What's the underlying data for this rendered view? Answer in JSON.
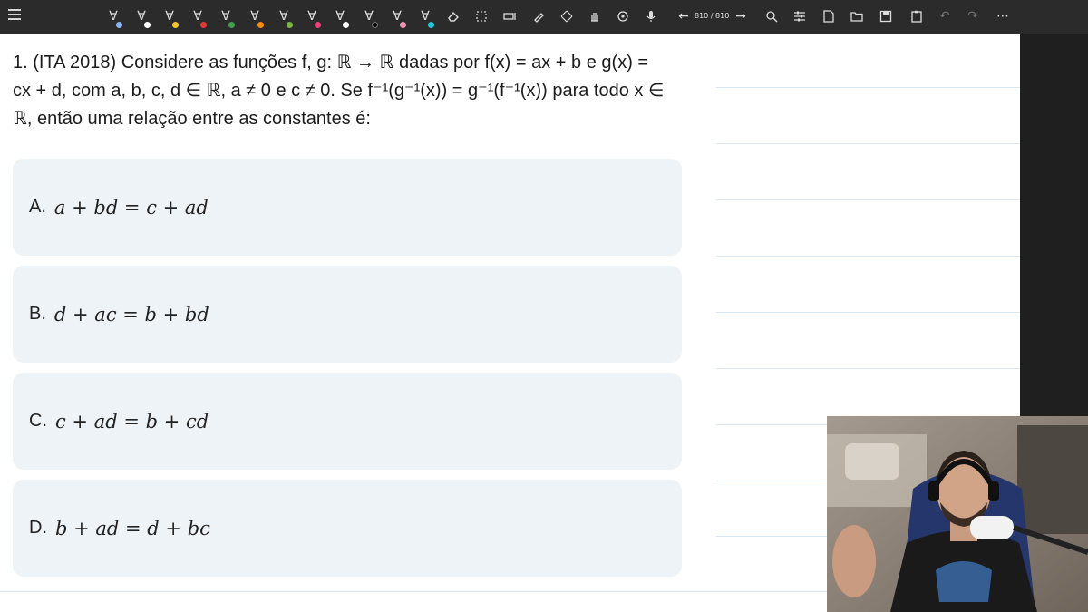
{
  "toolbar": {
    "menu_icon": "hamburger-icon",
    "pens": [
      {
        "icon": "pen-icon",
        "color": "#8ab4f8"
      },
      {
        "icon": "pen-icon",
        "color": "#ffffff"
      },
      {
        "icon": "pen-icon",
        "color": "#f4c430"
      },
      {
        "icon": "pen-icon",
        "color": "#e53935"
      },
      {
        "icon": "pen-icon",
        "color": "#43a047"
      },
      {
        "icon": "pen-icon",
        "color": "#fb8c00"
      },
      {
        "icon": "pen-icon",
        "color": "#7cb342"
      },
      {
        "icon": "pen-icon",
        "color": "#ec407a"
      },
      {
        "icon": "pen-icon",
        "color": "#ffffff"
      },
      {
        "icon": "pen-icon",
        "color": "#000000"
      },
      {
        "icon": "pen-icon",
        "color": "#f48fb1"
      },
      {
        "icon": "pen-icon",
        "color": "#26c6da"
      }
    ],
    "page_counter": "810 / 810"
  },
  "question": {
    "line1": "1. (ITA 2018) Considere as funções f, g: ℝ → ℝ dadas por f(x) = ax + b e g(x) =",
    "line2": "cx + d, com a, b, c, d ∈ ℝ, a ≠ 0 e c ≠ 0. Se f⁻¹(g⁻¹(x)) = g⁻¹(f⁻¹(x)) para todo x ∈",
    "line3": "ℝ, então uma relação entre as constantes é:"
  },
  "options": [
    {
      "letter": "A.",
      "formula": "a + bd = c + ad"
    },
    {
      "letter": "B.",
      "formula": "d + ac = b + bd"
    },
    {
      "letter": "C.",
      "formula": "c + ad = b + cd"
    },
    {
      "letter": "D.",
      "formula": "b + ad = d + bc"
    }
  ],
  "colors": {
    "toolbar_bg": "#2b2b2b",
    "option_bg": "#eef3f8",
    "rule": "#dbe8f3"
  }
}
